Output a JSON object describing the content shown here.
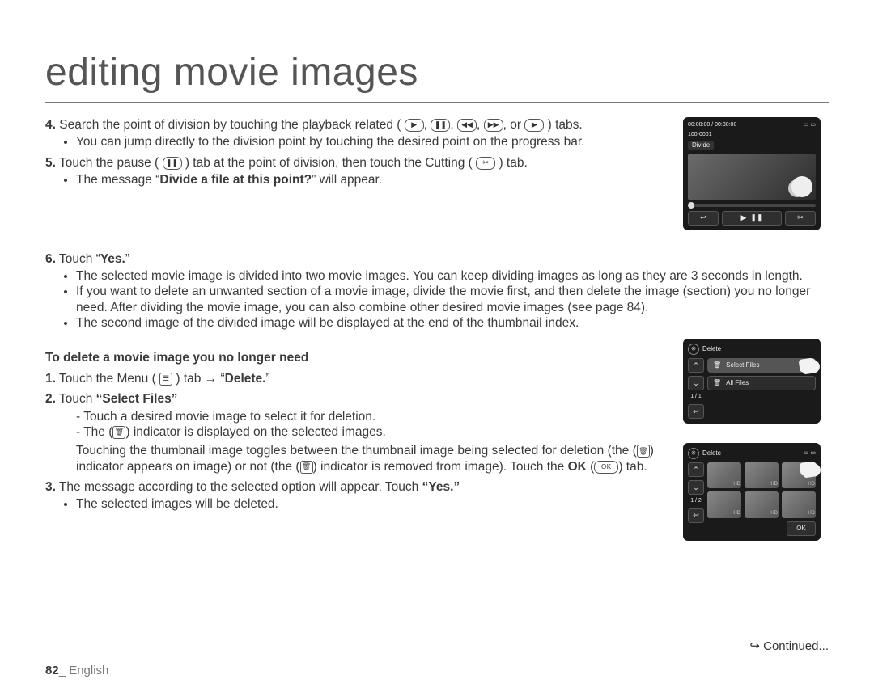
{
  "title": "editing movie images",
  "step4": {
    "num": "4.",
    "text_a": "Search the point of division by touching the playback related (",
    "text_b": ") tabs.",
    "sep": ", ",
    "sep_or": ", or ",
    "bullet1": "You can jump directly to the division point by touching the desired point on the progress bar."
  },
  "step5": {
    "num": "5.",
    "text_a": "Touch the pause (",
    "text_b": ") tab at the point of division, then touch the Cutting (",
    "text_c": ") tab.",
    "bullet1_a": "The message “",
    "bullet1_bold": "Divide a file at this point?",
    "bullet1_b": "” will appear."
  },
  "step6": {
    "num": "6.",
    "text_a": "Touch “",
    "bold": "Yes.",
    "text_b": "”",
    "bullet1": "The selected movie image is divided into two movie images. You can keep dividing images as long as they are 3 seconds in length.",
    "bullet2": "If you want to delete an unwanted section of a movie image, divide the movie first, and then delete the image (section) you no longer need. After dividing the movie image, you can also combine other desired movie images (see page 84).",
    "bullet3": "The second image of the divided image will be displayed at the end of the thumbnail index."
  },
  "delete_head": "To delete a movie image you no longer need",
  "d1": {
    "num": "1.",
    "text_a": "Touch the Menu (",
    "text_b": ") tab ",
    "arrow": "→",
    "text_c": " “",
    "bold": "Delete.",
    "text_d": "”"
  },
  "d2": {
    "num": "2.",
    "text_a": "Touch ",
    "bold": "“Select Files”",
    "dash1": "Touch a desired movie image to select it for deletion.",
    "dash2_a": "The (",
    "dash2_b": ") indicator is displayed on the selected images.",
    "dash3_a": "Touching the thumbnail image toggles between the thumbnail image being selected for deletion (the (",
    "dash3_b": ") indicator appears on image) or not (the (",
    "dash3_c": ") indicator is removed from image). Touch the ",
    "dash3_ok": "OK",
    "dash3_d": " (",
    "dash3_e": ") tab."
  },
  "d3": {
    "num": "3.",
    "text_a": "The message according to the selected option will appear. Touch ",
    "bold": "“Yes.”",
    "bullet1": "The selected images will be deleted."
  },
  "continued": "Continued...",
  "page_number": "82",
  "page_lang": "_ English",
  "screenshot1": {
    "time": "00:00:00 / 00:30:00",
    "file": "100-0001",
    "label": "Divide"
  },
  "screenshot2": {
    "title": "Delete",
    "opt1": "Select Files",
    "opt2": "All Files",
    "pager": "1 / 1"
  },
  "screenshot3": {
    "title": "Delete",
    "pager": "1 / 2",
    "ok": "OK"
  },
  "icons": {
    "play": "▶",
    "pause": "❚❚",
    "rew": "◀◀",
    "ffwd": "▶▶",
    "play2": "▶",
    "scissors": "✂",
    "menu": "☰",
    "trash": "Ὕ1",
    "ok": "OK",
    "back": "↩",
    "up": "⌃",
    "down": "⌄"
  }
}
